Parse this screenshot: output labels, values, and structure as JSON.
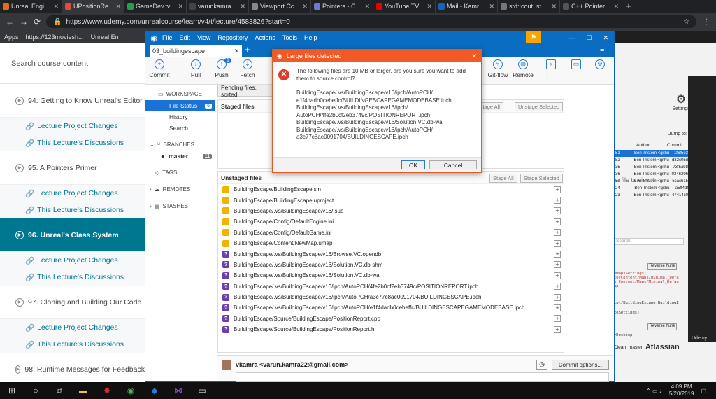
{
  "browser": {
    "tabs": [
      "Unreal Engi",
      "UPositionRe",
      "GameDev.tv",
      "varunkamra",
      "Viewport Cc",
      "Pointers - C",
      "YouTube TV",
      "Mail - Kamr",
      "std::cout, st",
      "C++ Pointer"
    ],
    "url": "https://www.udemy.com/unrealcourse/learn/v4/t/lecture/4583826?start=0",
    "bookmarks": [
      "Apps",
      "https://123moviesh...",
      "Unreal En"
    ]
  },
  "udemy": {
    "search_placeholder": "Search course content",
    "items": [
      {
        "title": "94. Getting to Know Unreal's Editor",
        "current": false,
        "subs": [
          "Lecture Project Changes",
          "This Lecture's Discussions"
        ]
      },
      {
        "title": "95. A Pointers Primer",
        "current": false,
        "subs": [
          "Lecture Project Changes",
          "This Lecture's Discussions"
        ]
      },
      {
        "title": "96. Unreal's Class System",
        "current": true,
        "subs": [
          "Lecture Project Changes",
          "This Lecture's Discussions"
        ]
      },
      {
        "title": "97. Cloning and Building Our Code",
        "current": false,
        "subs": [
          "Lecture Project Changes",
          "This Lecture's Discussions"
        ]
      },
      {
        "title": "98. Runtime Messages for Feedback",
        "current": false,
        "subs": []
      }
    ]
  },
  "sourcetree": {
    "menu": [
      "File",
      "Edit",
      "View",
      "Repository",
      "Actions",
      "Tools",
      "Help"
    ],
    "repo_tab": "03_buildingescape",
    "toolbar": [
      "Commit",
      "Pull",
      "Push",
      "Fetch"
    ],
    "push_badge": "1",
    "toolbar_right": [
      "Git-flow",
      "Remote"
    ],
    "workspace": "WORKSPACE",
    "workspace_items": [
      "File Status",
      "History",
      "Search"
    ],
    "file_status_count": "6",
    "branches": "BRANCHES",
    "branch_master": "master",
    "branch_count": "11",
    "tags": "TAGS",
    "remotes": "REMOTES",
    "stashes": "STASHES",
    "pending": "Pending files, sorted",
    "staged_label": "Staged files",
    "unstage_all": "Unstage All",
    "unstage_selected": "Unstage Selected",
    "unstaged_label": "Unstaged files",
    "stage_all": "Stage All",
    "stage_selected": "Stage Selected",
    "files": [
      {
        "status": "M",
        "path": "BuildingEscape/BuildingEscape.sln"
      },
      {
        "status": "M",
        "path": "BuildingEscape/BuildingEscape.uproject"
      },
      {
        "status": "M",
        "path": "BuildingEscape/.vs/BuildingEscape/v16/.suo"
      },
      {
        "status": "M",
        "path": "BuildingEscape/Config/DefaultEngine.ini"
      },
      {
        "status": "M",
        "path": "BuildingEscape/Config/DefaultGame.ini"
      },
      {
        "status": "M",
        "path": "BuildingEscape/Content/NewMap.umap"
      },
      {
        "status": "?",
        "path": "BuildingEscape/.vs/BuildingEscape/v16/Browse.VC.opendb"
      },
      {
        "status": "?",
        "path": "BuildingEscape/.vs/BuildingEscape/v16/Solution.VC.db-shm"
      },
      {
        "status": "?",
        "path": "BuildingEscape/.vs/BuildingEscape/v16/Solution.VC.db-wal"
      },
      {
        "status": "?",
        "path": "BuildingEscape/.vs/BuildingEscape/v16/ipch/AutoPCH/4fe2b0cf2eb3749c/POSITIONREPORT.ipch"
      },
      {
        "status": "?",
        "path": "BuildingEscape/.vs/BuildingEscape/v16/ipch/AutoPCH/a3c77c8ae0091704/BUILDINGESCAPE.ipch"
      },
      {
        "status": "?",
        "path": "BuildingEscape/.vs/BuildingEscape/v16/ipch/AutoPCH/e1f4dadb0cebeffc/BUILDINGESCAPEGAMEMODEBASE.ipch"
      },
      {
        "status": "?",
        "path": "BuildingEscape/Source/BuildingEscape/PositionReport.cpp"
      },
      {
        "status": "?",
        "path": "BuildingEscape/Source/BuildingEscape/PositionReport.h"
      }
    ],
    "committer": "vkamra <varun.kamra22@gmail.com>",
    "commit_options": "Commit options...",
    "view_hint": "a file to view t",
    "search_placeholder": "Search"
  },
  "dialog": {
    "title": "Large files detected",
    "message": "The following files are 10 MB or larger, are you sure you want to add them to source control?",
    "files": [
      "BuildingEscape/.vs/BuildingEscape/v16/ipch/AutoPCH/",
      "e1f4dadb0cebeffc/BUILDINGESCAPEGAMEMODEBASE.ipch",
      "BuildingEscape/.vs/BuildingEscape/v16/ipch/",
      "AutoPCH/4fe2b0cf2eb3749c/POSITIONREPORT.ipch",
      "BuildingEscape/.vs/BuildingEscape/v16/Solution.VC.db-wal",
      "BuildingEscape/.vs/BuildingEscape/v16/ipch/AutoPCH/",
      "a3c77c8ae0091704/BUILDINGESCAPE.ipch"
    ],
    "ok": "OK",
    "cancel": "Cancel"
  },
  "right": {
    "settings": "Settings",
    "jump": "Jump to:",
    "author_h": "Author",
    "commit_h": "Commit",
    "rows": [
      [
        "51",
        "Ben Tristem <githu",
        "1f6f5e3"
      ],
      [
        "52",
        "Ben Tristem <githu",
        "d32c05d"
      ],
      [
        "35",
        "Ben Tristem <githu",
        "73f5a98"
      ],
      [
        "36",
        "Ben Tristem <githu",
        "0346396"
      ],
      [
        "57",
        "Ben Tristem <githu",
        "5cac615"
      ],
      [
        "24",
        "Ben Tristem <githu",
        "a5ff4df"
      ],
      [
        "23",
        "Ben Tristem <githu",
        "47414c0"
      ]
    ],
    "reverse_hunk": "Reverse hunk",
    "code_lines": [
      "eMapsSettings]",
      "terContent/Maps/Minimal_Defa",
      "erContent/Maps/Minimal_Defau",
      "ap"
    ],
    "path_line": "ipt/BuildingEscape.BuildingE",
    "settings_line": "ceSettings]",
    "desktop_line": "=Desktop",
    "bottom_clean": "Clean",
    "bottom_master": "master",
    "brand": "Atlassian",
    "udemy": "Udemy"
  },
  "taskbar": {
    "time": "4:09 PM",
    "date": "5/20/2019"
  }
}
